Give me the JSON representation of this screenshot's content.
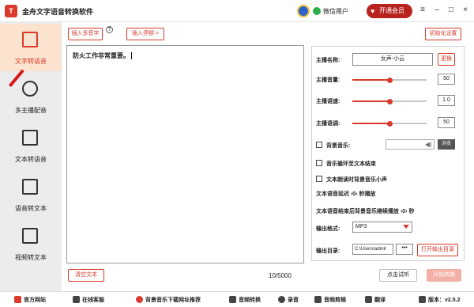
{
  "titlebar": {
    "app_title": "金舟文字语音转换软件",
    "user": "微信用户",
    "vip": "开通会员"
  },
  "sidebar": {
    "items": [
      {
        "label": "文字转语音"
      },
      {
        "label": "多主播配音"
      },
      {
        "label": "文本转语音"
      },
      {
        "label": "语音转文本"
      },
      {
        "label": "视频转文本"
      }
    ]
  },
  "toolbar": {
    "insert_multi": "插入多音字",
    "insert_pause": "插入停顿 >",
    "init_settings": "初始化设置"
  },
  "editor": {
    "text": "防火工作非常重要。",
    "counter": "10/5000"
  },
  "buttons": {
    "clear": "清空文本",
    "preview": "点击试听",
    "convert": "开始转换"
  },
  "panel": {
    "voice_label": "主播名称:",
    "voice_value": "女声-小云",
    "change": "更换",
    "volume_label": "主播音量:",
    "volume": "50",
    "volume_level": 0.5,
    "speed_label": "主播语速:",
    "speed": "1.0",
    "speed_level": 0.5,
    "pitch_label": "主播语调:",
    "pitch": "50",
    "pitch_level": 0.5,
    "bgm_label": "背景音乐:",
    "browse": "浏览",
    "loop_label": "音乐循环至文本结束",
    "lower_label": "文本朗读时背景音乐小声",
    "delay_line": "文本语音延迟 ‹0› 秒播放",
    "after_line": "文本语音结束后背景音乐继续播放 ‹0› 秒",
    "format_label": "输出格式:",
    "format_value": "MP3",
    "dir_label": "输出目录:",
    "dir_value": "C:\\Users\\admir",
    "dots": "•••",
    "open_dir": "打开输出目录"
  },
  "footer": {
    "site": "官方网站",
    "service": "在线客服",
    "bgm_site": "背景音乐下载网址推荐",
    "audio_convert": "音频转换",
    "record": "录音",
    "audio_edit": "音频剪辑",
    "translate": "翻译",
    "version": "版本：v2.5.2"
  },
  "colors": {
    "accent": "#d93a2b",
    "active_bg": "#fbe3cf",
    "sidebar_bg": "#ececec"
  }
}
